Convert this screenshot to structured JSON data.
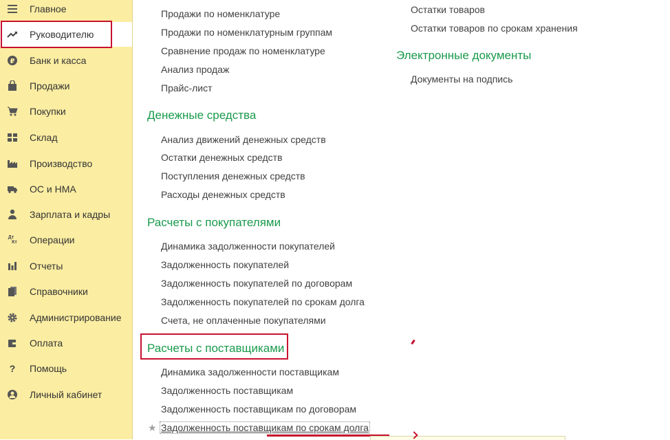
{
  "sidebar": {
    "items": [
      {
        "label": "Главное",
        "icon": "menu-lines-icon"
      },
      {
        "label": "Руководителю",
        "icon": "trend-up-icon"
      },
      {
        "label": "Банк и касса",
        "icon": "ruble-coin-icon"
      },
      {
        "label": "Продажи",
        "icon": "shopping-bag-icon"
      },
      {
        "label": "Покупки",
        "icon": "cart-icon"
      },
      {
        "label": "Склад",
        "icon": "warehouse-icon"
      },
      {
        "label": "Производство",
        "icon": "factory-icon"
      },
      {
        "label": "ОС и НМА",
        "icon": "truck-icon"
      },
      {
        "label": "Зарплата и кадры",
        "icon": "person-icon"
      },
      {
        "label": "Операции",
        "icon": "dt-kt-icon",
        "icon_text_top": "Дт",
        "icon_text_bottom": "Кт"
      },
      {
        "label": "Отчеты",
        "icon": "bar-chart-icon"
      },
      {
        "label": "Справочники",
        "icon": "books-icon"
      },
      {
        "label": "Администрирование",
        "icon": "gear-icon"
      },
      {
        "label": "Оплата",
        "icon": "wallet-icon"
      },
      {
        "label": "Помощь",
        "icon": "question-icon",
        "icon_text": "?"
      },
      {
        "label": "Личный кабинет",
        "icon": "user-circle-icon"
      }
    ],
    "active_index": 1
  },
  "left_column": {
    "top_links": [
      "Продажи по номенклатуре",
      "Продажи по номенклатурным группам",
      "Сравнение продаж по номенклатуре",
      "Анализ продаж",
      "Прайс-лист"
    ],
    "money": {
      "title": "Денежные средства",
      "links": [
        "Анализ движений денежных средств",
        "Остатки денежных средств",
        "Поступления денежных средств",
        "Расходы денежных средств"
      ]
    },
    "customers": {
      "title": "Расчеты с покупателями",
      "links": [
        "Динамика задолженности покупателей",
        "Задолженность покупателей",
        "Задолженность покупателей по договорам",
        "Задолженность покупателей по срокам долга",
        "Счета, не оплаченные покупателями"
      ]
    },
    "suppliers": {
      "title": "Расчеты с поставщиками",
      "links": [
        "Динамика задолженности поставщикам",
        "Задолженность поставщикам",
        "Задолженность поставщикам по договорам",
        "Задолженность поставщикам по срокам долга"
      ]
    }
  },
  "right_column": {
    "top_links": [
      "Остатки товаров",
      "Остатки товаров по срокам хранения"
    ],
    "edocs": {
      "title": "Электронные документы",
      "links": [
        "Документы на подпись"
      ]
    }
  },
  "colors": {
    "sidebar_bg": "#fbeda2",
    "section_green": "#1a9a4c",
    "highlight_red": "#c8102e",
    "link_text": "#404040"
  }
}
